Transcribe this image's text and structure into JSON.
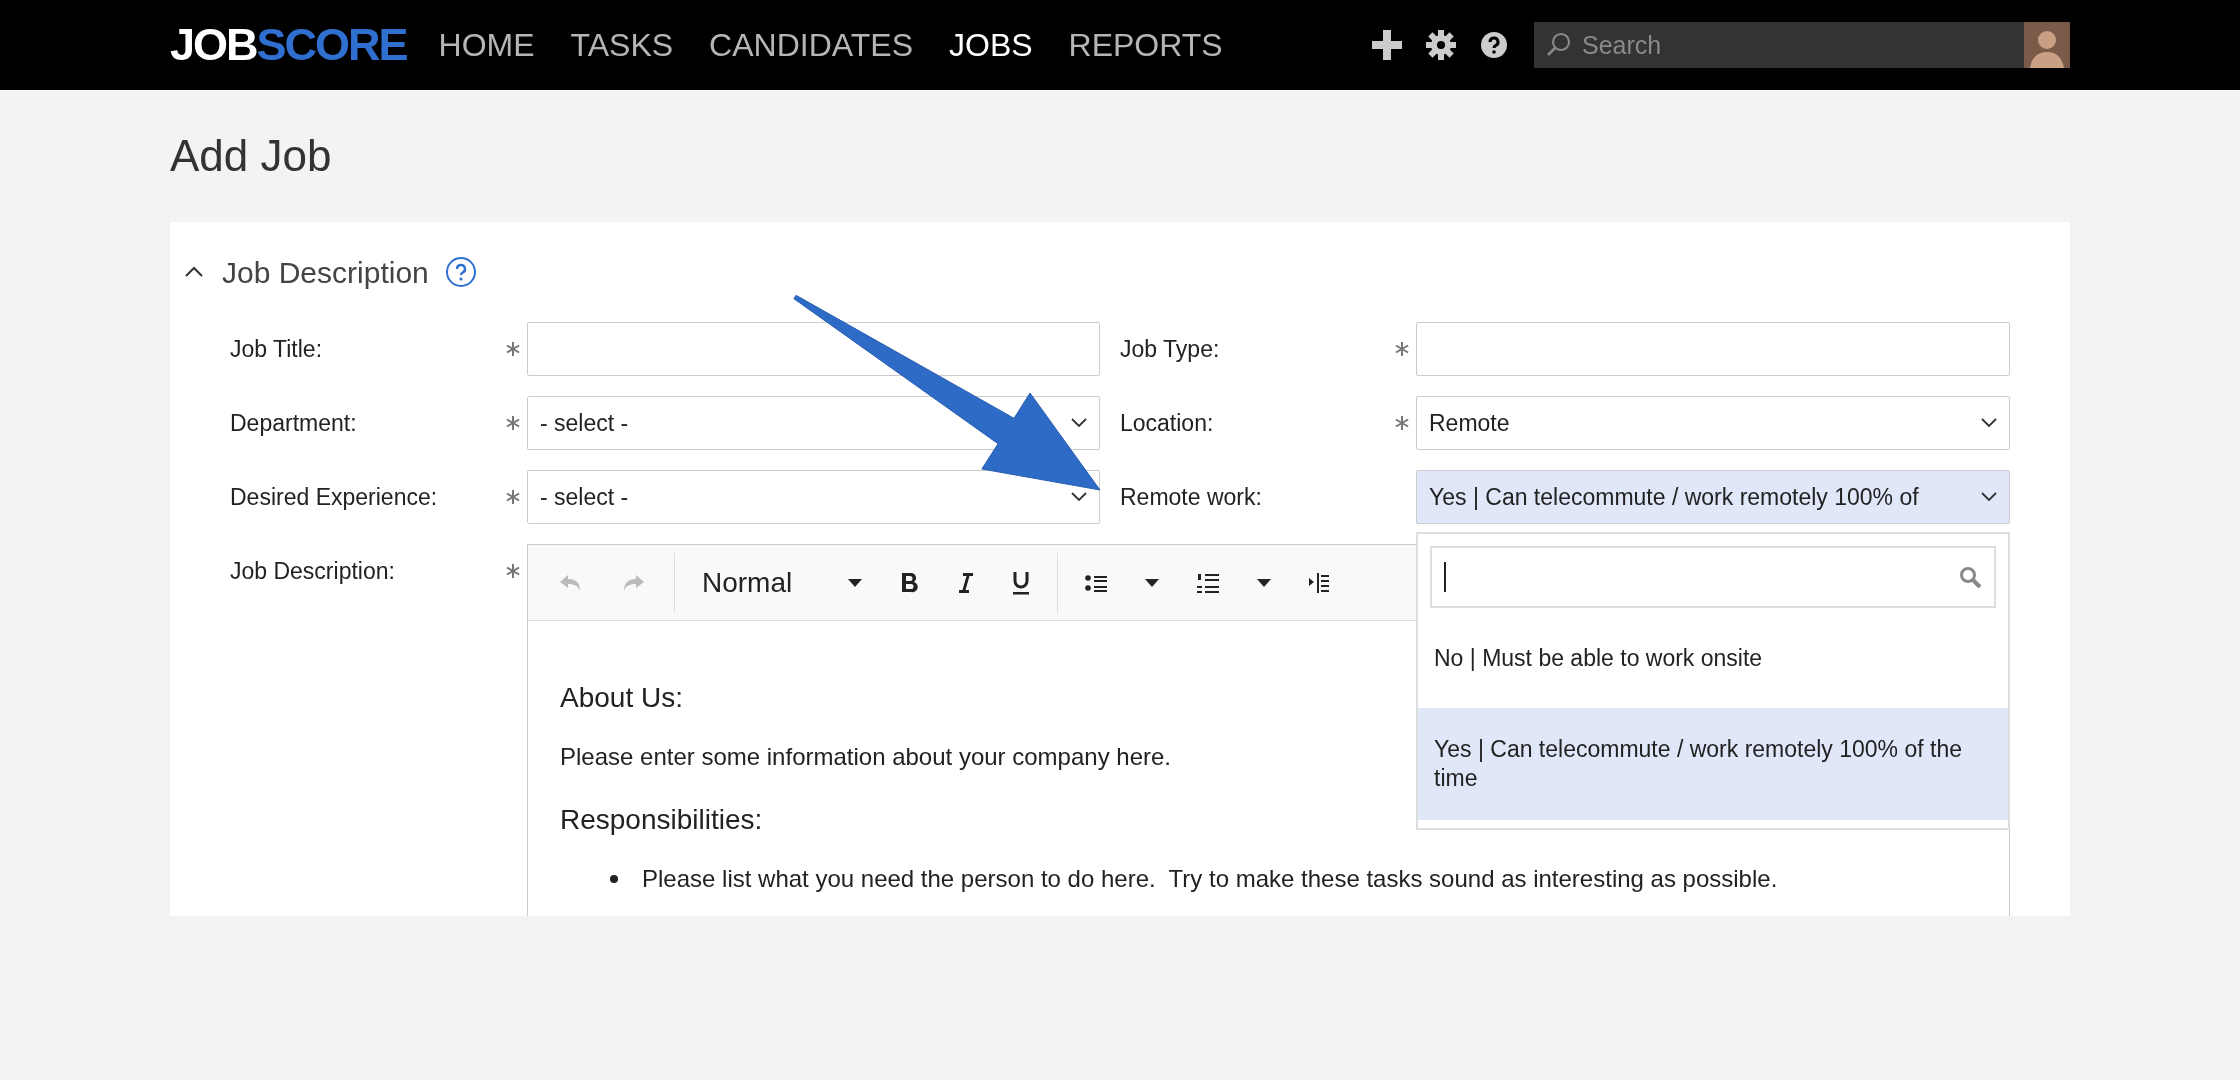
{
  "navbar": {
    "logo": [
      "JOB",
      "SCORE"
    ],
    "items": [
      {
        "label": "HOME",
        "selected": false
      },
      {
        "label": "TASKS",
        "selected": false
      },
      {
        "label": "CANDIDATES",
        "selected": false
      },
      {
        "label": "JOBS",
        "selected": true
      },
      {
        "label": "REPORTS",
        "selected": false
      }
    ],
    "search": {
      "placeholder": "Search"
    }
  },
  "page_title": "Add Job",
  "section": {
    "title": "Job Description",
    "expanded": true
  },
  "fields": [
    {
      "label": "Job Title:",
      "required": true,
      "kind": "text"
    },
    {
      "label": "Job Type:",
      "required": true,
      "kind": "text"
    },
    {
      "label": "Department:",
      "required": true,
      "kind": "select",
      "value": "- select -"
    },
    {
      "label": "Location:",
      "required": true,
      "kind": "select",
      "value": "Remote"
    },
    {
      "label": "Desired Experience:",
      "required": true,
      "kind": "select",
      "value": "- select -"
    },
    {
      "label": "Remote work:",
      "required": false,
      "kind": "select",
      "value": "Yes | Can telecommute / work remotely 100% of",
      "open": true
    }
  ],
  "editor": {
    "label": "Job Description:",
    "required": true,
    "style": "Normal",
    "content": [
      {
        "kind": "heading",
        "text": "About Us:"
      },
      {
        "kind": "paragraph",
        "text": "Please enter some information about your company here."
      },
      {
        "kind": "heading",
        "text": "Responsibilities:"
      },
      {
        "kind": "bullet",
        "text": "Please list what you need the person to do here.  Try to make these tasks sound as interesting as possible."
      }
    ]
  },
  "dropdown": {
    "options": [
      {
        "text": "No | Must be able to work onsite",
        "selected": false
      },
      {
        "text": "Yes | Can telecommute / work remotely 100% of the time",
        "selected": true
      }
    ]
  },
  "callout_arrow": true
}
